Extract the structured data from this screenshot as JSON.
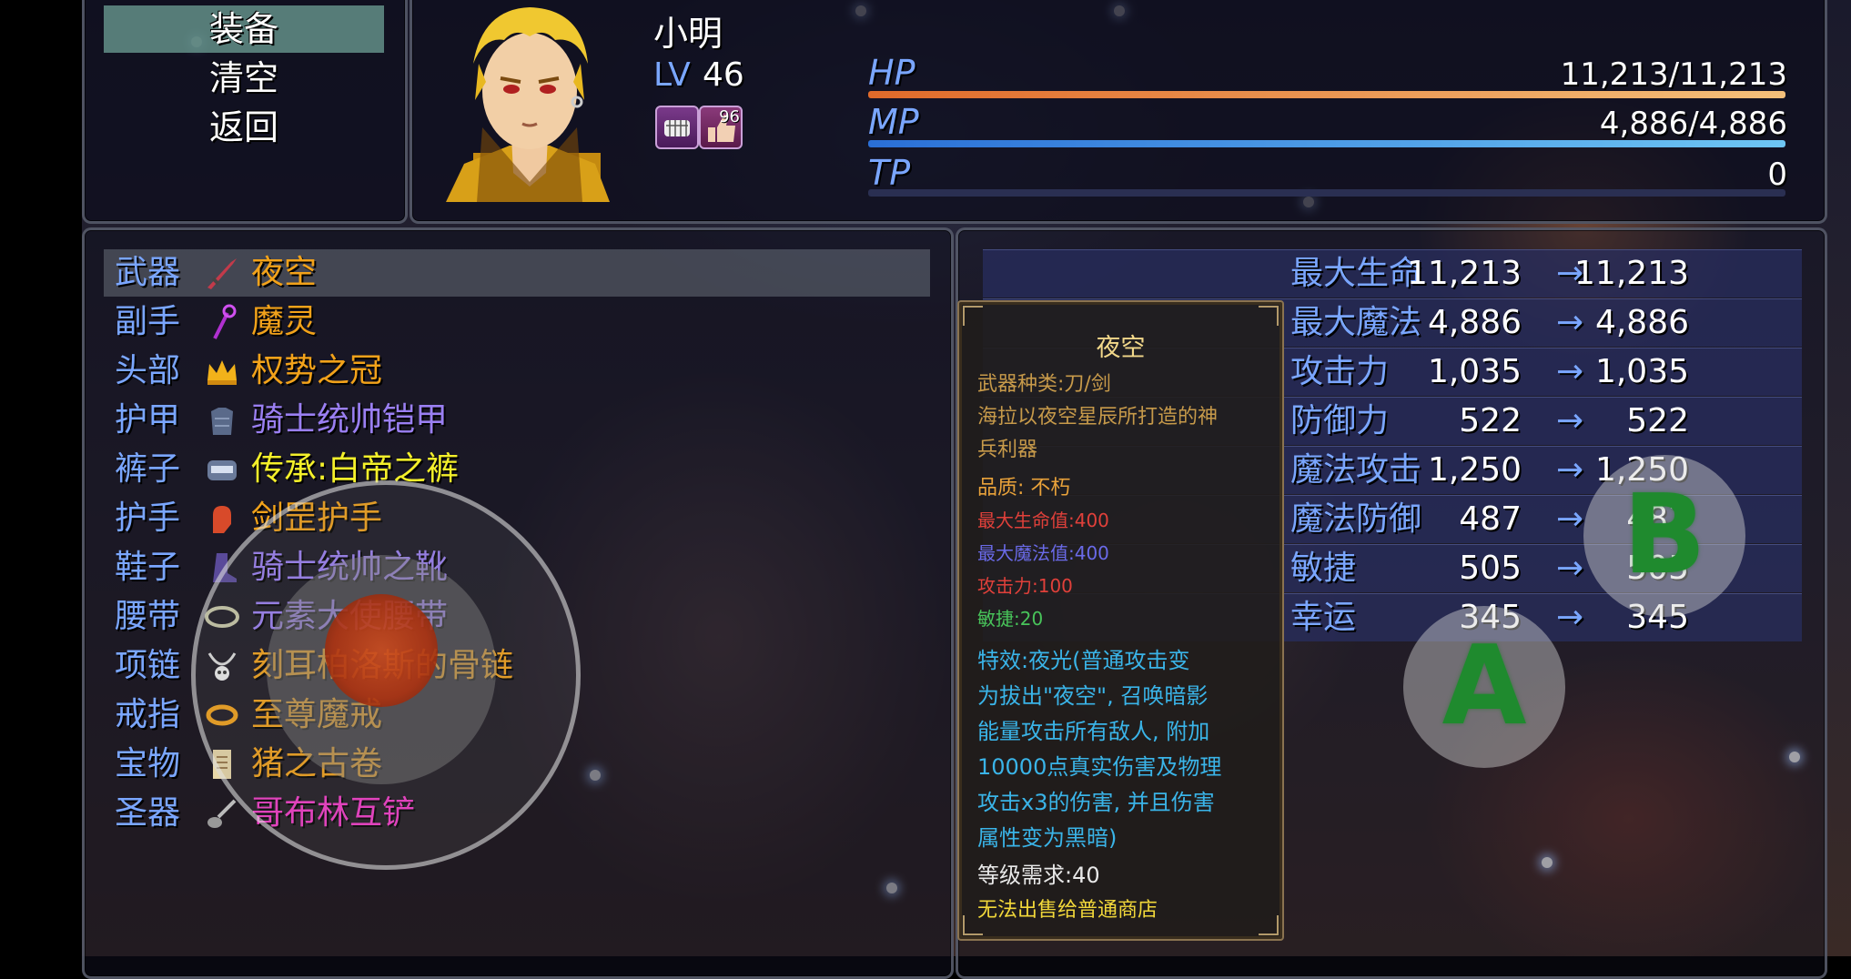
{
  "command_menu": {
    "items": [
      {
        "label": "装备",
        "selected": true
      },
      {
        "label": "清空",
        "selected": false
      },
      {
        "label": "返回",
        "selected": false
      }
    ]
  },
  "actor": {
    "name": "小明",
    "level_label": "LV",
    "level": "46",
    "states": [
      {
        "icon": "angry-face-icon",
        "turns": ""
      },
      {
        "icon": "thumbs-up-icon",
        "turns": "96"
      }
    ]
  },
  "gauges": {
    "hp": {
      "label": "HP",
      "value": "11,213/11,213",
      "fill_ratio": 1.0,
      "color_from": "#e06a2a",
      "color_to": "#f4c07a"
    },
    "mp": {
      "label": "MP",
      "value": "4,886/4,886",
      "fill_ratio": 1.0,
      "color_from": "#2a6fd6",
      "color_to": "#6ec6f4"
    },
    "tp": {
      "label": "TP",
      "value": "0",
      "fill_ratio": 0.0
    }
  },
  "equip_slots": [
    {
      "slot": "武器",
      "item": "夜空",
      "icon": "sword-icon",
      "color": "#f2a21a",
      "selected": true
    },
    {
      "slot": "副手",
      "item": "魔灵",
      "icon": "staff-icon",
      "color": "#f2a21a"
    },
    {
      "slot": "头部",
      "item": "权势之冠",
      "icon": "crown-icon",
      "color": "#f2a21a"
    },
    {
      "slot": "护甲",
      "item": "骑士统帅铠甲",
      "icon": "armor-icon",
      "color": "#9a7ff2"
    },
    {
      "slot": "裤子",
      "item": "传承:白帝之裤",
      "icon": "pants-icon",
      "color": "#f4f02a"
    },
    {
      "slot": "护手",
      "item": "剑罡护手",
      "icon": "gauntlet-icon",
      "color": "#f2a21a"
    },
    {
      "slot": "鞋子",
      "item": "骑士统帅之靴",
      "icon": "boots-icon",
      "color": "#9a7ff2"
    },
    {
      "slot": "腰带",
      "item": "元素大使腰带",
      "icon": "belt-icon",
      "color": "#9a7ff2"
    },
    {
      "slot": "项链",
      "item": "刻耳柏洛斯的骨链",
      "icon": "skull-necklace-icon",
      "color": "#f2a21a"
    },
    {
      "slot": "戒指",
      "item": "至尊魔戒",
      "icon": "ring-icon",
      "color": "#f2a21a"
    },
    {
      "slot": "宝物",
      "item": "猪之古卷",
      "icon": "scroll-icon",
      "color": "#f2a21a"
    },
    {
      "slot": "圣器",
      "item": "哥布林互铲",
      "icon": "shovel-icon",
      "color": "#f23ac8"
    }
  ],
  "stats": {
    "arrow": "→",
    "rows": [
      {
        "name": "最大生命",
        "old": "11,213",
        "new": "11,213"
      },
      {
        "name": "最大魔法",
        "old": "4,886",
        "new": "4,886"
      },
      {
        "name": "攻击力",
        "old": "1,035",
        "new": "1,035"
      },
      {
        "name": "防御力",
        "old": "522",
        "new": "522"
      },
      {
        "name": "魔法攻击",
        "old": "1,250",
        "new": "1,250"
      },
      {
        "name": "魔法防御",
        "old": "487",
        "new": "487"
      },
      {
        "name": "敏捷",
        "old": "505",
        "new": "505"
      },
      {
        "name": "幸运",
        "old": "345",
        "new": "345"
      }
    ]
  },
  "item_info": {
    "title": "夜空",
    "lines": [
      {
        "text": "武器种类:刀/剑",
        "color": "#c79a4a"
      },
      {
        "text": "海拉以夜空星辰所打造的神",
        "color": "#c79a4a"
      },
      {
        "text": "兵利器",
        "color": "#c79a4a"
      },
      {
        "text": "品质: 不朽",
        "color": "#e9a23a"
      },
      {
        "text": "最大生命值:400",
        "color": "#e0403a"
      },
      {
        "text": "最大魔法值:400",
        "color": "#6a6ae8"
      },
      {
        "text": "攻击力:100",
        "color": "#e0403a"
      },
      {
        "text": "敏捷:20",
        "color": "#48c45a"
      },
      {
        "text": "特效:夜光(普通攻击变",
        "color": "#3ab4e8"
      },
      {
        "text": "为拔出\"夜空\", 召唤暗影",
        "color": "#3ab4e8"
      },
      {
        "text": "能量攻击所有敌人, 附加",
        "color": "#3ab4e8"
      },
      {
        "text": "10000点真实伤害及物理",
        "color": "#3ab4e8"
      },
      {
        "text": "攻击x3的伤害, 并且伤害",
        "color": "#3ab4e8"
      },
      {
        "text": "属性变为黑暗)",
        "color": "#3ab4e8"
      },
      {
        "text": "等级需求:40",
        "color": "#e8e8e8"
      },
      {
        "text": "无法出售给普通商店",
        "color": "#f2d83a"
      }
    ]
  },
  "touch_buttons": {
    "a": "A",
    "b": "B"
  }
}
